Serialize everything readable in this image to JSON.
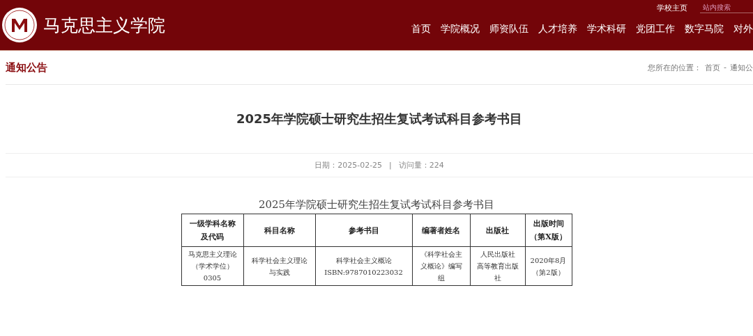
{
  "header": {
    "site_name": "马克思主义学院",
    "top_link": "学校主页",
    "search": {
      "placeholder": "站内搜索"
    },
    "nav": [
      "首页",
      "学院概况",
      "师资队伍",
      "人才培养",
      "学术科研",
      "党团工作",
      "数字马院",
      "对外"
    ]
  },
  "section": {
    "title": "通知公告",
    "breadcrumb_label": "您所在的位置：",
    "breadcrumb": [
      "首页",
      "通知公"
    ],
    "breadcrumb_separator": "-"
  },
  "article": {
    "title": "2025年学院硕士研究生招生复试考试科目参考书目",
    "date": "日期：2025-02-25",
    "meta_separator": "|",
    "views": "访问量：224",
    "table": {
      "caption": "2025年学院硕士研究生招生复试考试科目参考书目",
      "columns": [
        "一级学科名称及代码",
        "科目名称",
        "参考书目",
        "编著者姓名",
        "出版社",
        "出版时间（第X版）"
      ],
      "rows": [
        [
          "马克思主义理论（学术学位）0305",
          "科学社会主义理论与实践",
          [
            "科学社会主义概论",
            "ISBN:9787010223032"
          ],
          "《科学社会主义概论》编写组",
          [
            "人民出版社",
            "高等教育出版社"
          ],
          "2020年8月（第2版）"
        ]
      ]
    }
  }
}
